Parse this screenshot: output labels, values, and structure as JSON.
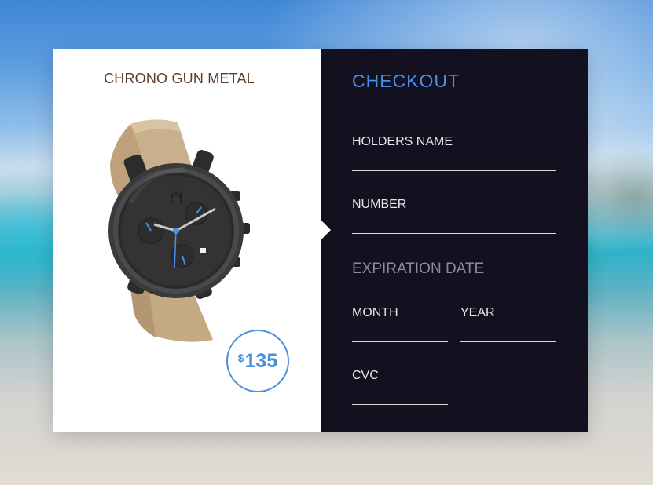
{
  "product": {
    "title": "CHRONO GUN METAL",
    "price_currency": "$",
    "price_amount": "135"
  },
  "checkout": {
    "title": "CHECKOUT",
    "holders_name_label": "HOLDERS NAME",
    "holders_name_value": "",
    "number_label": "NUMBER",
    "number_value": "",
    "expiration_label": "EXPIRATION DATE",
    "month_label": "MONTH",
    "month_value": "",
    "year_label": "YEAR",
    "year_value": "",
    "cvc_label": "CVC",
    "cvc_value": ""
  },
  "colors": {
    "accent": "#4a8fe8",
    "panel_dark": "#13101f",
    "product_title": "#5b3d2a"
  },
  "icons": {
    "watch_image": "wristwatch-image",
    "pointer": "triangle-pointer-icon"
  }
}
